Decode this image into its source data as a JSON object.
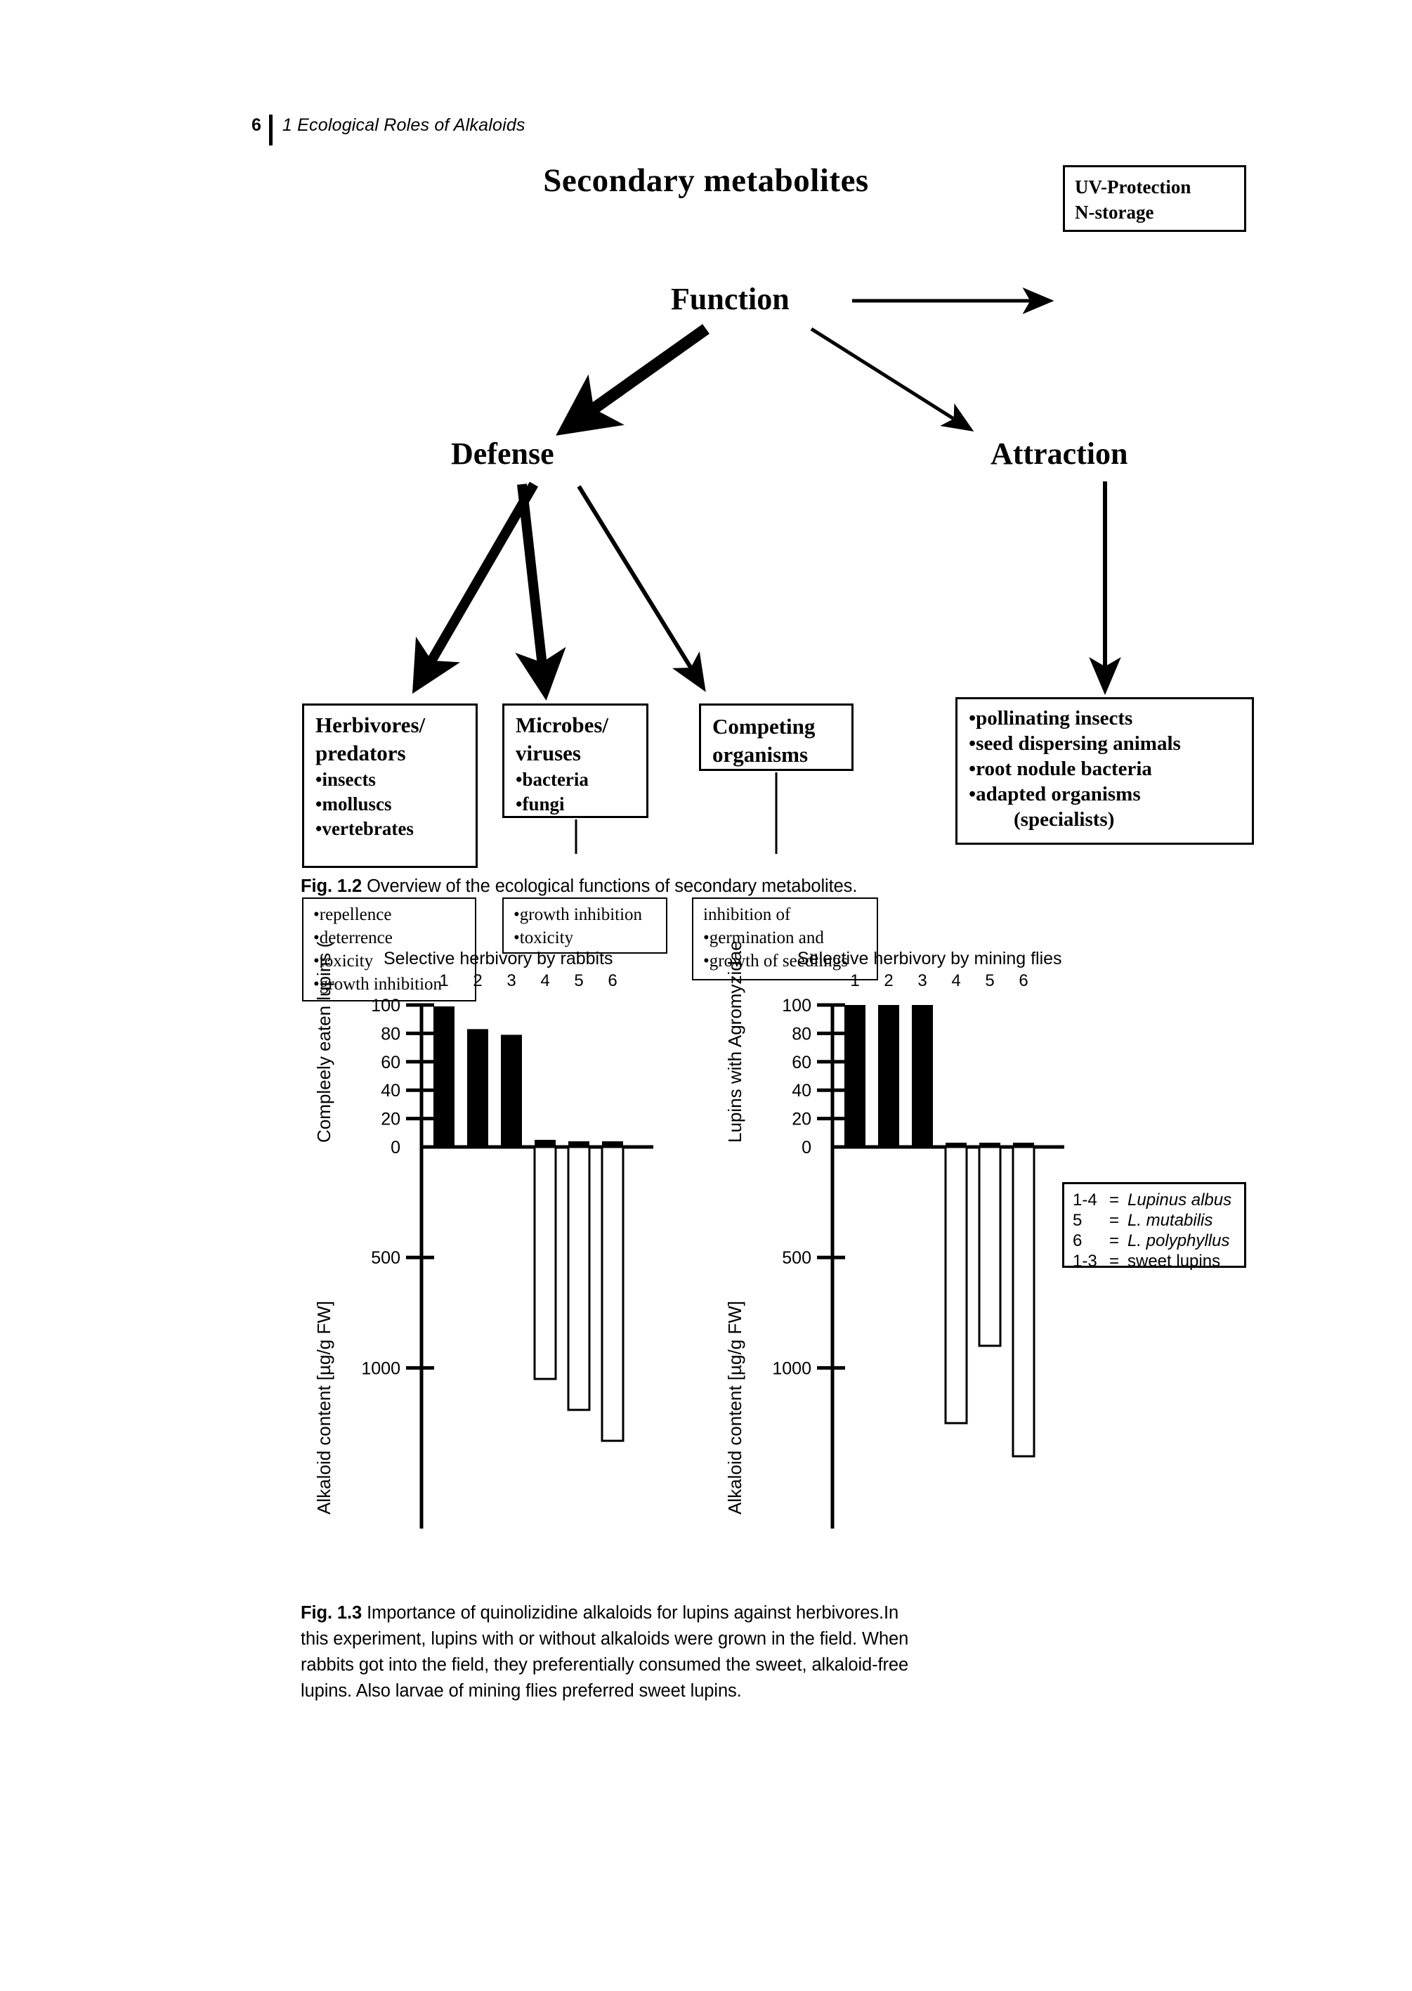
{
  "header": {
    "page_number": "6",
    "chapter_title": "1 Ecological Roles of Alkaloids"
  },
  "figure_1_2": {
    "title": "Secondary metabolites",
    "nodes": {
      "function": "Function",
      "defense": "Defense",
      "attraction": "Attraction"
    },
    "box_uv": {
      "line1": "UV-Protection",
      "line2": "N-storage"
    },
    "box_herbivores": {
      "head1": "Herbivores/",
      "head2": "predators",
      "item1": "•insects",
      "item2": "•molluscs",
      "item3": "•vertebrates"
    },
    "box_microbes": {
      "head1": "Microbes/",
      "head2": "viruses",
      "item1": "•bacteria",
      "item2": "•fungi"
    },
    "box_competing": {
      "head1": "Competing",
      "head2": "organisms"
    },
    "box_attraction": {
      "item1": "•pollinating insects",
      "item2": "•seed dispersing animals",
      "item3": "•root nodule bacteria",
      "item4": "•adapted organisms",
      "item5": "(specialists)"
    },
    "box_repellence": {
      "item1": "•repellence",
      "item2": "•deterrence",
      "item3": "•toxicity",
      "item4": "•growth inhibition"
    },
    "box_growth_inhibition": {
      "item1": "•growth inhibition",
      "item2": "•toxicity"
    },
    "box_inhibition_of": {
      "item1": "inhibition of",
      "item2": "•germination and",
      "item3": "•growth of seedlings"
    },
    "caption_label": "Fig. 1.2",
    "caption_text": "Overview of the ecological functions of secondary metabolites."
  },
  "figure_1_3": {
    "caption_label": "Fig. 1.3",
    "caption_text": "Importance of quinolizidine alkaloids for lupins against herbivores.In this experiment, lupins with or without alkaloids were grown in the field. When rabbits got into the field, they preferentially consumed the sweet, alkaloid-free lupins. Also larvae of mining flies preferred sweet lupins.",
    "legend": [
      {
        "key": "1-4",
        "eq": "=",
        "value": "Lupinus albus",
        "italic": true
      },
      {
        "key": "5",
        "eq": "=",
        "value": "L. mutabilis",
        "italic": true
      },
      {
        "key": "6",
        "eq": "=",
        "value": "L. polyphyllus",
        "italic": true
      },
      {
        "key": "1-3",
        "eq": "=",
        "value": "sweet lupins",
        "italic": false
      }
    ]
  },
  "chart_data": [
    {
      "type": "bar",
      "title": "Selective herbivory by rabbits",
      "categories": [
        "1",
        "2",
        "3",
        "4",
        "5",
        "6"
      ],
      "xlabel": "",
      "panels": [
        {
          "ylabel": "Compleely eaten lupins (%)",
          "values": [
            99,
            83,
            79,
            5,
            4,
            4
          ],
          "ylim": [
            0,
            100
          ],
          "yticks": [
            0,
            20,
            40,
            60,
            80,
            100
          ],
          "ytick_labels": [
            "0",
            "20",
            "40",
            "60",
            "80",
            "100"
          ],
          "fill": "solid"
        },
        {
          "ylabel": "Alkaloid content [µg/g FW]",
          "values": [
            0,
            0,
            0,
            1050,
            1190,
            1330
          ],
          "ylim": [
            0,
            1600
          ],
          "yticks": [
            500,
            1000
          ],
          "ytick_labels": [
            "500",
            "1000"
          ],
          "direction": "down",
          "fill": "open"
        }
      ],
      "grid": false,
      "legend_position": "none"
    },
    {
      "type": "bar",
      "title": "Selective herbivory by mining flies",
      "categories": [
        "1",
        "2",
        "3",
        "4",
        "5",
        "6"
      ],
      "xlabel": "",
      "panels": [
        {
          "ylabel": "Lupins with Agromyzidae (%)",
          "values": [
            100,
            100,
            100,
            3,
            3,
            3
          ],
          "ylim": [
            0,
            100
          ],
          "yticks": [
            0,
            20,
            40,
            60,
            80,
            100
          ],
          "ytick_labels": [
            "0",
            "20",
            "40",
            "60",
            "80",
            "100"
          ],
          "fill": "solid"
        },
        {
          "ylabel": "Alkaloid content [µg/g FW]",
          "values": [
            0,
            0,
            0,
            1250,
            900,
            1400
          ],
          "ylim": [
            0,
            1600
          ],
          "yticks": [
            500,
            1000
          ],
          "ytick_labels": [
            "500",
            "1000"
          ],
          "direction": "down",
          "fill": "open"
        }
      ],
      "grid": false,
      "legend_position": "right"
    }
  ]
}
